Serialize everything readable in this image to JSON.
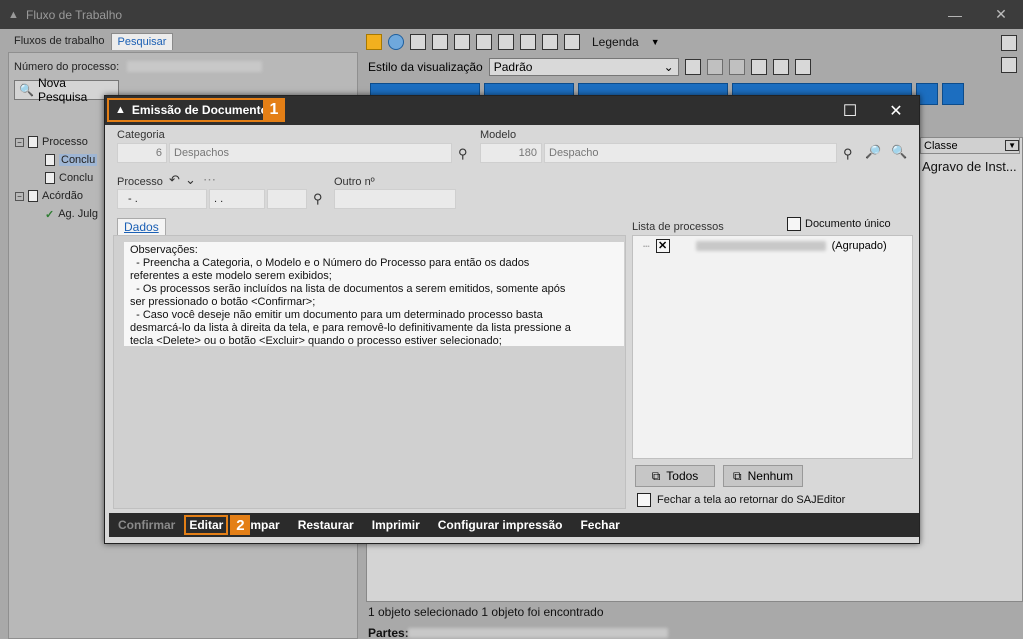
{
  "main": {
    "title": "Fluxo de Trabalho",
    "minimize": "—",
    "close": "✕"
  },
  "left": {
    "tabs": [
      "Fluxos de trabalho",
      "Pesquisar"
    ],
    "numero_label": "Número do processo:",
    "nova_pesquisa": "Nova Pesquisa",
    "tree": {
      "processo": "Processo",
      "item1": "Conclu",
      "item2": "Conclu",
      "acordao": "Acórdão",
      "ag": "Ag. Julg"
    }
  },
  "right": {
    "legenda": "Legenda",
    "estilo_label": "Estilo da visualização",
    "estilo_value": "Padrão",
    "column_classe": "Classe",
    "cell_classe": "Agravo de Inst...",
    "status1": "1 objeto selecionado   1 objeto foi encontrado",
    "partes_label": "Partes:"
  },
  "modal": {
    "title": "Emissão de Documentos",
    "badge1": "1",
    "badge2": "2",
    "categoria_label": "Categoria",
    "categoria_num": "6",
    "categoria_text": "Despachos",
    "modelo_label": "Modelo",
    "modelo_num": "180",
    "modelo_text": "Despacho",
    "processo_label": "Processo",
    "processo_part1": "-  .",
    "processo_part2": ".  .",
    "outro_label": "Outro nº",
    "dados_tab": "Dados",
    "observacoes": "Observações:\n  - Preencha a Categoria, o Modelo e o Número do Processo para então os dados\nreferentes a este modelo serem exibidos;\n  - Os processos serão incluídos na lista de documentos a serem emitidos, somente após\nser pressionado o botão <Confirmar>;\n  - Caso você deseje não emitir um documento para um determinado processo basta\ndesmarcá-lo da lista à direita da tela, e para removê-lo definitivamente da lista pressione a\ntecla <Delete> ou o botão <Excluir> quando o processo estiver selecionado;",
    "lista_label": "Lista de processos",
    "doc_unico": "Documento único",
    "agrupado": "(Agrupado)",
    "todos": "Todos",
    "nenhum": "Nenhum",
    "fechar_label": "Fechar a tela ao retornar do SAJEditor",
    "buttons": {
      "confirmar": "Confirmar",
      "editar": "Editar",
      "limpar": "mpar",
      "restaurar": "Restaurar",
      "imprimir": "Imprimir",
      "configurar": "Configurar impressão",
      "fechar": "Fechar"
    }
  },
  "colors": {
    "accent_orange": "#e47f16",
    "tab_blue": "#1c6ec0"
  }
}
